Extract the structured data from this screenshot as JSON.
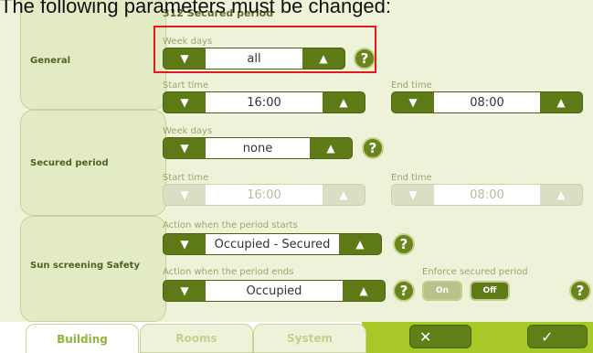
{
  "caption": "The following parameters must be changed:",
  "header": {
    "title": "312 Secured period"
  },
  "sections": {
    "general": "General",
    "secured": "Secured period",
    "sun": "Sun screening Safety"
  },
  "general": {
    "week_days_label": "Week days",
    "week_days_value": "all",
    "start_label": "Start time",
    "start_value": "16:00",
    "end_label": "End time",
    "end_value": "08:00"
  },
  "secured": {
    "week_days_label": "Week days",
    "week_days_value": "none",
    "start_label": "Start time",
    "start_value": "16:00",
    "end_label": "End time",
    "end_value": "08:00"
  },
  "sun": {
    "starts_label": "Action when the period starts",
    "starts_value": "Occupied - Secured",
    "ends_label": "Action when the period ends",
    "ends_value": "Occupied",
    "enforce_label": "Enforce secured period",
    "on_label": "On",
    "off_label": "Off"
  },
  "icons": {
    "down": "▼",
    "up": "▲",
    "help": "?",
    "cancel": "✕",
    "confirm": "✓"
  },
  "tabs": [
    "Building",
    "Rooms",
    "System"
  ],
  "colors": {
    "accent": "#5e7a16",
    "highlight": "#e21a1a",
    "active_tab": "#a7c827"
  }
}
